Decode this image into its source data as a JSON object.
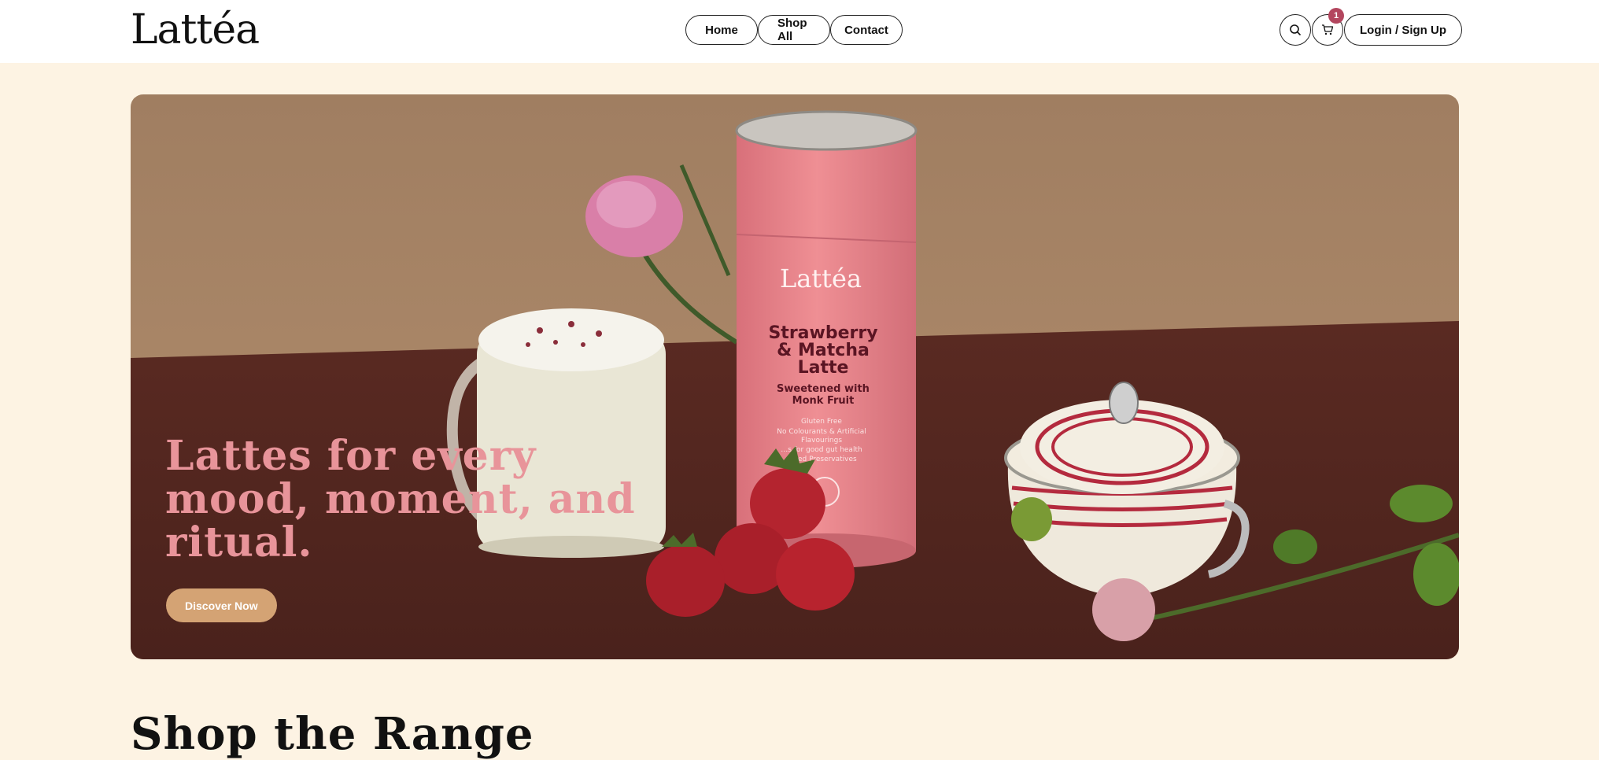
{
  "header": {
    "logo": "Lattéa",
    "nav": {
      "home": "Home",
      "shop_all": "Shop All",
      "contact": "Contact"
    },
    "search_icon": "search-icon",
    "cart_icon": "cart-icon",
    "cart_count": "1",
    "login_label": "Login / Sign Up"
  },
  "hero": {
    "heading": "Lattes for every mood, moment, and ritual.",
    "cta_label": "Discover Now",
    "product": {
      "brand": "Lattéa",
      "name_line1": "Strawberry",
      "name_line2": "& Matcha",
      "name_line3": "Latte",
      "sub_line1": "Sweetened with",
      "sub_line2": "Monk Fruit",
      "claim1": "Gluten Free",
      "claim2": "No Colourants & Artificial",
      "claim3": "Flavourings",
      "claim4": "…s for good gut health",
      "claim5": "…ded Preservatives"
    }
  },
  "section": {
    "title": "Shop the Range"
  },
  "colors": {
    "accent": "#b3465e",
    "hero_text": "#e8949a",
    "cta": "#d4a374",
    "page_bg": "#fdf3e3"
  }
}
